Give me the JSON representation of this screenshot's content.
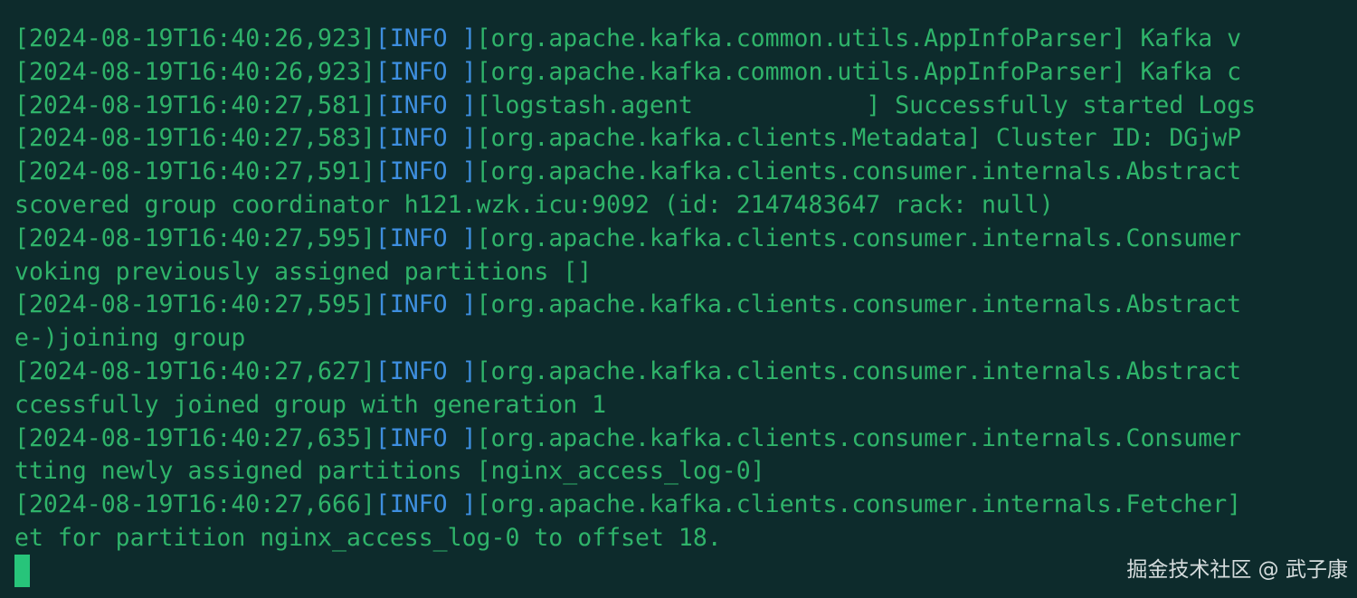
{
  "terminal": {
    "colors": {
      "background": "#0d2b2c",
      "text": "#2fb36a",
      "level": "#3e8fe0",
      "cursor": "#27c47a"
    },
    "lines": [
      {
        "ts": "[2024-08-19T16:40:26,923]",
        "lvl": "[INFO ]",
        "msg": "[org.apache.kafka.common.utils.AppInfoParser] Kafka v"
      },
      {
        "ts": "[2024-08-19T16:40:26,923]",
        "lvl": "[INFO ]",
        "msg": "[org.apache.kafka.common.utils.AppInfoParser] Kafka c"
      },
      {
        "ts": "[2024-08-19T16:40:27,581]",
        "lvl": "[INFO ]",
        "msg": "[logstash.agent            ] Successfully started Logs"
      },
      {
        "ts": "[2024-08-19T16:40:27,583]",
        "lvl": "[INFO ]",
        "msg": "[org.apache.kafka.clients.Metadata] Cluster ID: DGjwP"
      },
      {
        "ts": "[2024-08-19T16:40:27,591]",
        "lvl": "[INFO ]",
        "msg": "[org.apache.kafka.clients.consumer.internals.Abstract"
      },
      {
        "ts": "",
        "lvl": "",
        "msg": "scovered group coordinator h121.wzk.icu:9092 (id: 2147483647 rack: null)"
      },
      {
        "ts": "[2024-08-19T16:40:27,595]",
        "lvl": "[INFO ]",
        "msg": "[org.apache.kafka.clients.consumer.internals.Consumer"
      },
      {
        "ts": "",
        "lvl": "",
        "msg": "voking previously assigned partitions []"
      },
      {
        "ts": "[2024-08-19T16:40:27,595]",
        "lvl": "[INFO ]",
        "msg": "[org.apache.kafka.clients.consumer.internals.Abstract"
      },
      {
        "ts": "",
        "lvl": "",
        "msg": "e-)joining group"
      },
      {
        "ts": "[2024-08-19T16:40:27,627]",
        "lvl": "[INFO ]",
        "msg": "[org.apache.kafka.clients.consumer.internals.Abstract"
      },
      {
        "ts": "",
        "lvl": "",
        "msg": "ccessfully joined group with generation 1"
      },
      {
        "ts": "[2024-08-19T16:40:27,635]",
        "lvl": "[INFO ]",
        "msg": "[org.apache.kafka.clients.consumer.internals.Consumer"
      },
      {
        "ts": "",
        "lvl": "",
        "msg": "tting newly assigned partitions [nginx_access_log-0]"
      },
      {
        "ts": "[2024-08-19T16:40:27,666]",
        "lvl": "[INFO ]",
        "msg": "[org.apache.kafka.clients.consumer.internals.Fetcher]"
      },
      {
        "ts": "",
        "lvl": "",
        "msg": "et for partition nginx_access_log-0 to offset 18."
      }
    ]
  },
  "watermark": {
    "text": "掘金技术社区 @ 武子康"
  }
}
